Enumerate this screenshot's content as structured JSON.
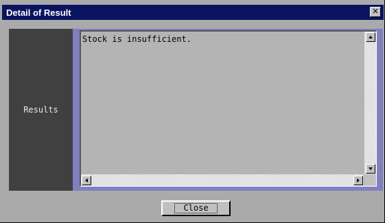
{
  "window": {
    "title": "Detail of Result",
    "close_icon": "close-icon"
  },
  "results": {
    "label": "Results",
    "text": "Stock is insufficient."
  },
  "footer": {
    "close_label": "Close"
  },
  "colors": {
    "titlebar": "#0a1460",
    "background": "#aaaaaa",
    "label_panel": "#404040",
    "frame": "#8080c0",
    "textarea": "#b4b4b4"
  }
}
